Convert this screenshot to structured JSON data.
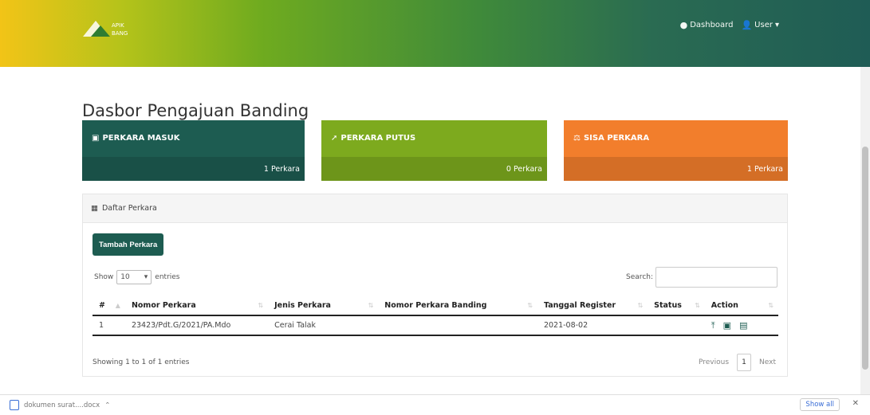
{
  "navbar": {
    "logo_text": "APIK BANG",
    "dashboard_label": "Dashboard",
    "user_label": "User"
  },
  "page": {
    "title": "Dasbor Pengajuan Banding"
  },
  "cards": [
    {
      "title": "PERKARA MASUK",
      "count": "1 Perkara",
      "color": "#1d5c51"
    },
    {
      "title": "PERKARA PUTUS",
      "count": "0 Perkara",
      "color": "#7daa1e"
    },
    {
      "title": "SISA PERKARA",
      "count": "1 Perkara",
      "color": "#f27e2c"
    }
  ],
  "panel": {
    "title": "Daftar Perkara",
    "add_button": "Tambah Perkara",
    "show_label": "Show",
    "entries_value": "10",
    "entries_label": "entries",
    "search_label": "Search:",
    "columns": [
      "#",
      "Nomor Perkara",
      "Jenis Perkara",
      "Nomor Perkara Banding",
      "Tanggal Register",
      "Status",
      "Action"
    ],
    "rows": [
      {
        "no": "1",
        "nomor": "23423/Pdt.G/2021/PA.Mdo",
        "jenis": "Cerai Talak",
        "banding": "",
        "tanggal": "2021-08-02",
        "status": ""
      }
    ],
    "info": "Showing 1 to 1 of 1 entries",
    "previous": "Previous",
    "page": "1",
    "next": "Next"
  },
  "download_bar": {
    "file": "dokumen surat....docx",
    "show_all": "Show all"
  }
}
